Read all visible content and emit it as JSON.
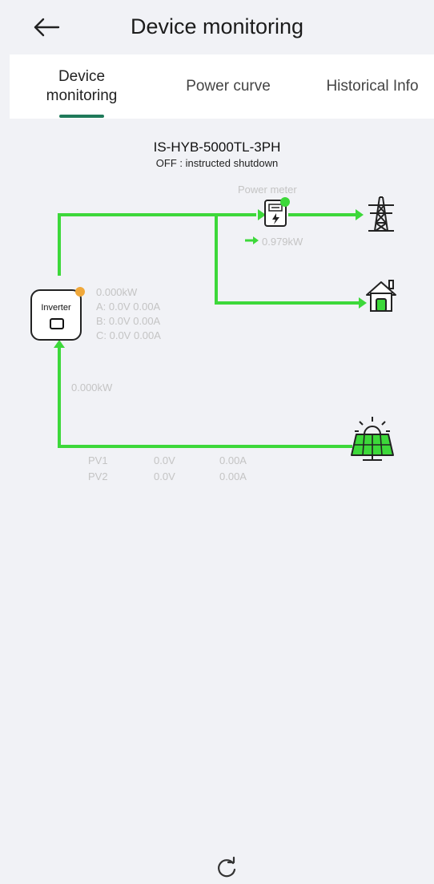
{
  "header": {
    "title": "Device monitoring",
    "back_icon": "back-arrow-icon"
  },
  "tabs": [
    {
      "label": "Device\nmonitoring",
      "active": true
    },
    {
      "label": "Power curve",
      "active": false
    },
    {
      "label": "Historical Info",
      "active": false
    }
  ],
  "device": {
    "model": "IS-HYB-5000TL-3PH",
    "status": "OFF : instructed shutdown"
  },
  "diagram": {
    "power_meter_label": "Power meter",
    "meter_power": "0.979kW",
    "inverter_label": "Inverter",
    "inverter_power": "0.000kW",
    "phase_a": "A: 0.0V 0.00A",
    "phase_b": "B: 0.0V 0.00A",
    "phase_c": "C: 0.0V 0.00A",
    "pv_power": "0.000kW",
    "pv_rows": [
      {
        "name": "PV1",
        "voltage": "0.0V",
        "current": "0.00A"
      },
      {
        "name": "PV2",
        "voltage": "0.0V",
        "current": "0.00A"
      }
    ]
  },
  "colors": {
    "flow": "#3dd83a",
    "accent": "#1f7a5a",
    "status_dot": "#f0a83a",
    "muted_text": "#c4c4c4"
  },
  "icons": [
    "back-arrow-icon",
    "power-meter-icon",
    "grid-tower-icon",
    "home-icon",
    "solar-panel-icon",
    "inverter-icon",
    "refresh-icon"
  ]
}
